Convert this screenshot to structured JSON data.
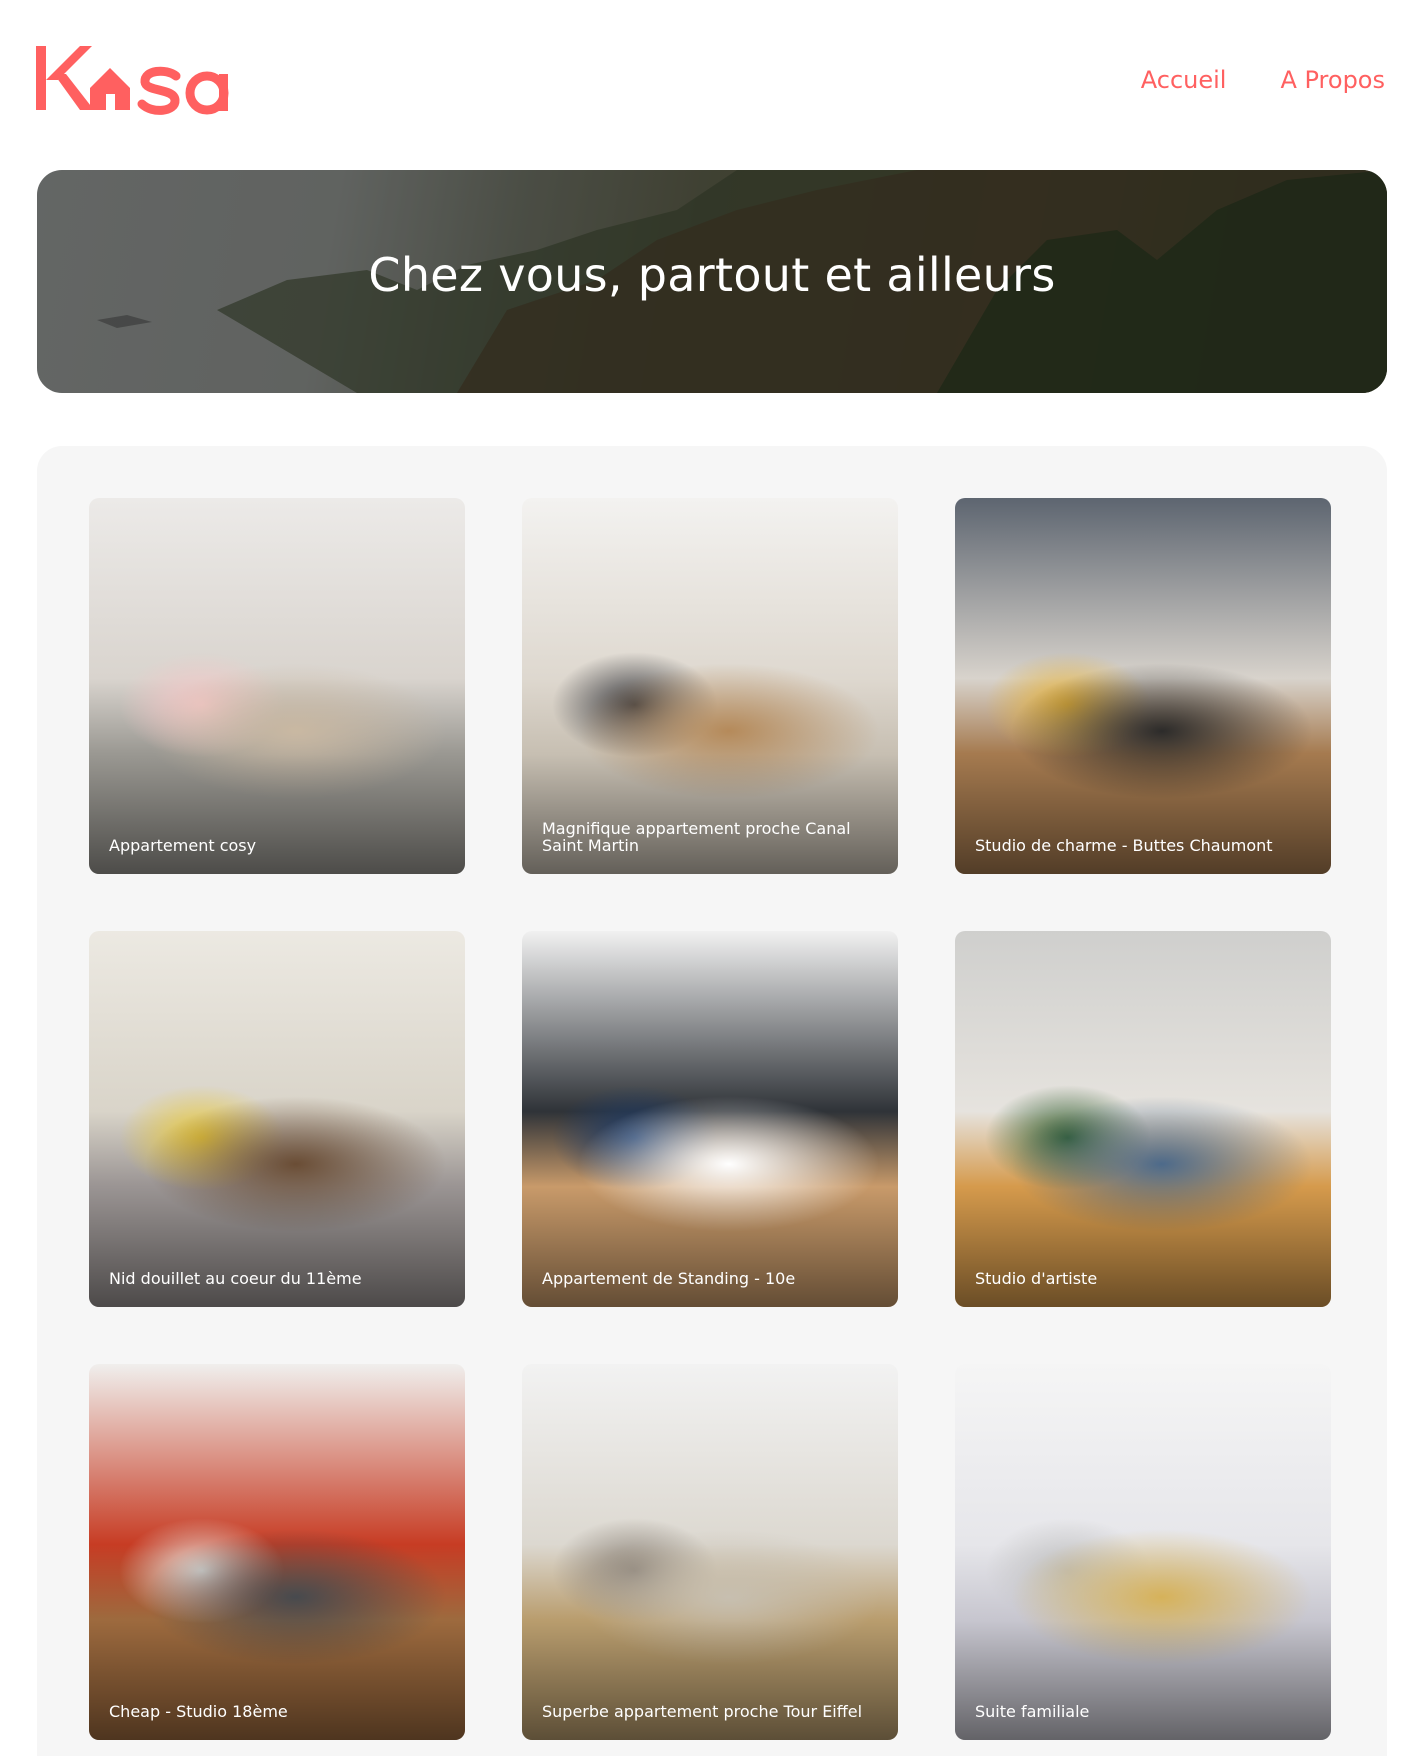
{
  "brand": {
    "name": "Kasa",
    "accent": "#ff6060"
  },
  "nav": {
    "items": [
      {
        "label": "Accueil"
      },
      {
        "label": "A Propos"
      }
    ]
  },
  "banner": {
    "title": "Chez vous, partout et ailleurs"
  },
  "listings": [
    {
      "title": "Appartement cosy",
      "palette": [
        "#eceae8",
        "#d9d4ce",
        "#9a9892",
        "#c9b8a2",
        "#f4c7c7"
      ]
    },
    {
      "title": "Magnifique appartement proche Canal Saint Martin",
      "palette": [
        "#f3f2f0",
        "#ded8cf",
        "#c7bfb2",
        "#b58a5a",
        "#3a3b40"
      ]
    },
    {
      "title": "Studio de charme - Buttes Chaumont",
      "palette": [
        "#5d6570",
        "#d8d3cc",
        "#a57a4f",
        "#2c2b2a",
        "#e5b23a"
      ]
    },
    {
      "title": "Nid douillet au coeur du 11ème",
      "palette": [
        "#ece9e2",
        "#d9d4c9",
        "#9a9493",
        "#6a4d35",
        "#e8c93a"
      ]
    },
    {
      "title": "Appartement de Standing - 10e",
      "palette": [
        "#f1f1f1",
        "#2f3338",
        "#c89a6a",
        "#ffffff",
        "#1d3c6a"
      ]
    },
    {
      "title": "Studio d'artiste",
      "palette": [
        "#cfcfcd",
        "#e6e3de",
        "#d59a4c",
        "#4d6a8a",
        "#2f5c2c"
      ]
    },
    {
      "title": "Cheap - Studio 18ème",
      "palette": [
        "#f0efed",
        "#c73c24",
        "#9d6a3e",
        "#474a4e",
        "#e8e6e1"
      ]
    },
    {
      "title": "Superbe appartement proche Tour Eiffel",
      "palette": [
        "#f2f2f2",
        "#dcd8d0",
        "#b99d6e",
        "#c7bfb0",
        "#8a8177"
      ]
    },
    {
      "title": "Suite familiale",
      "palette": [
        "#f5f5f5",
        "#e6e6ea",
        "#c7c6cf",
        "#d6b25a",
        "#bfbfbf"
      ]
    }
  ]
}
